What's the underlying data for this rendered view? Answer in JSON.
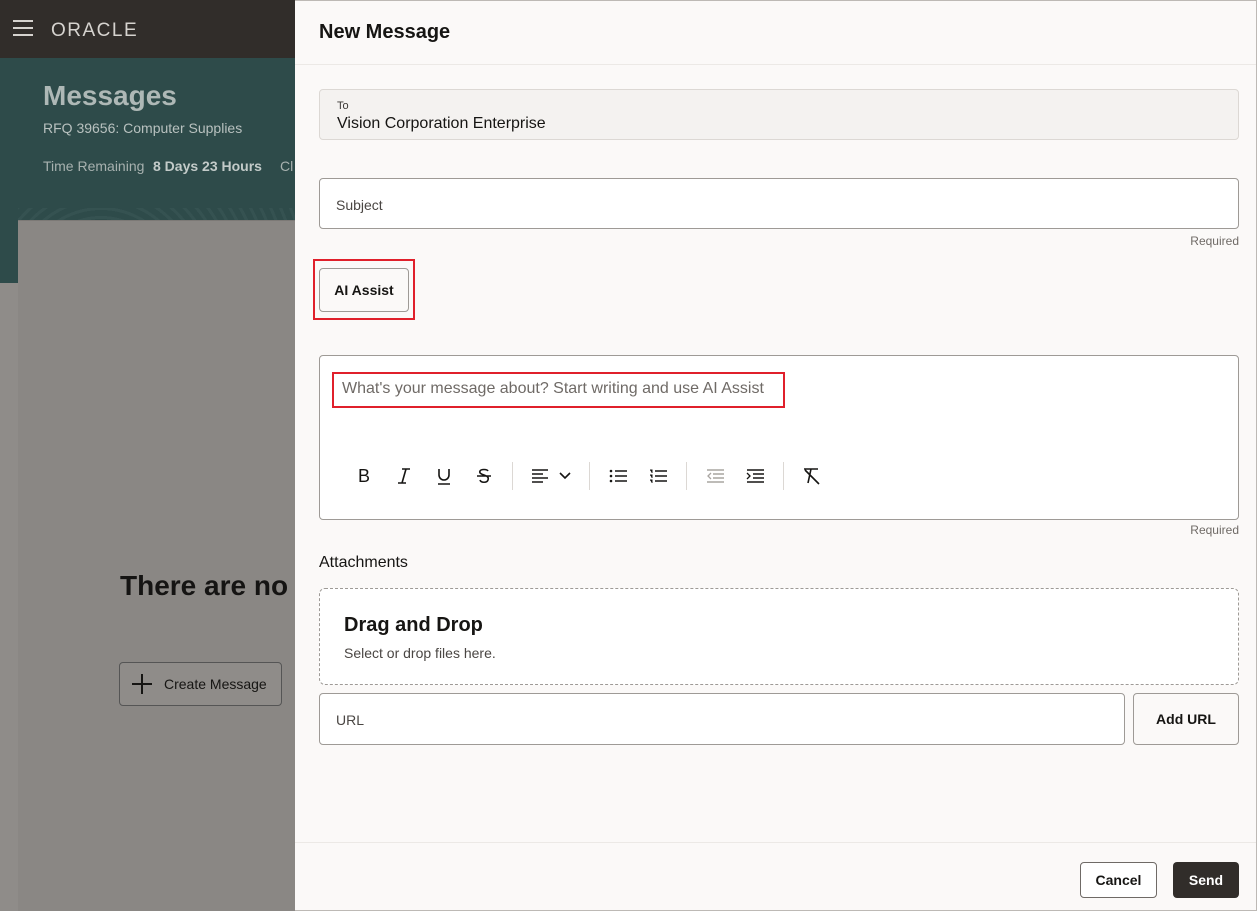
{
  "background": {
    "brand": "ORACLE",
    "page_title": "Messages",
    "rfq": "RFQ 39656: Computer Supplies",
    "time_remaining_label": "Time Remaining",
    "time_remaining_value": "8 Days 23 Hours",
    "close_fragment": "Cl",
    "empty_state_fragment": "There are no",
    "create_message_label": "Create Message"
  },
  "drawer": {
    "title": "New Message",
    "to": {
      "label": "To",
      "value": "Vision Corporation Enterprise"
    },
    "subject": {
      "placeholder": "Subject",
      "helper": "Required"
    },
    "ai_assist_label": "AI Assist",
    "editor": {
      "placeholder": "What's your message about? Start writing and use AI Assist",
      "helper": "Required",
      "toolbar": [
        "bold-icon",
        "italic-icon",
        "underline-icon",
        "strikethrough-icon",
        "align-icon",
        "chevron-down-icon",
        "bullet-list-icon",
        "numbered-list-icon",
        "outdent-icon",
        "indent-icon",
        "clear-format-icon"
      ]
    },
    "attachments": {
      "label": "Attachments",
      "drop_title": "Drag and Drop",
      "drop_subtitle": "Select or drop files here.",
      "url_placeholder": "URL",
      "add_url_label": "Add URL"
    },
    "footer": {
      "cancel_label": "Cancel",
      "send_label": "Send"
    }
  },
  "colors": {
    "highlight": "#e0202b",
    "banner": "#2e4b4a",
    "header": "#312d2a",
    "primary_button": "#312d2a"
  }
}
